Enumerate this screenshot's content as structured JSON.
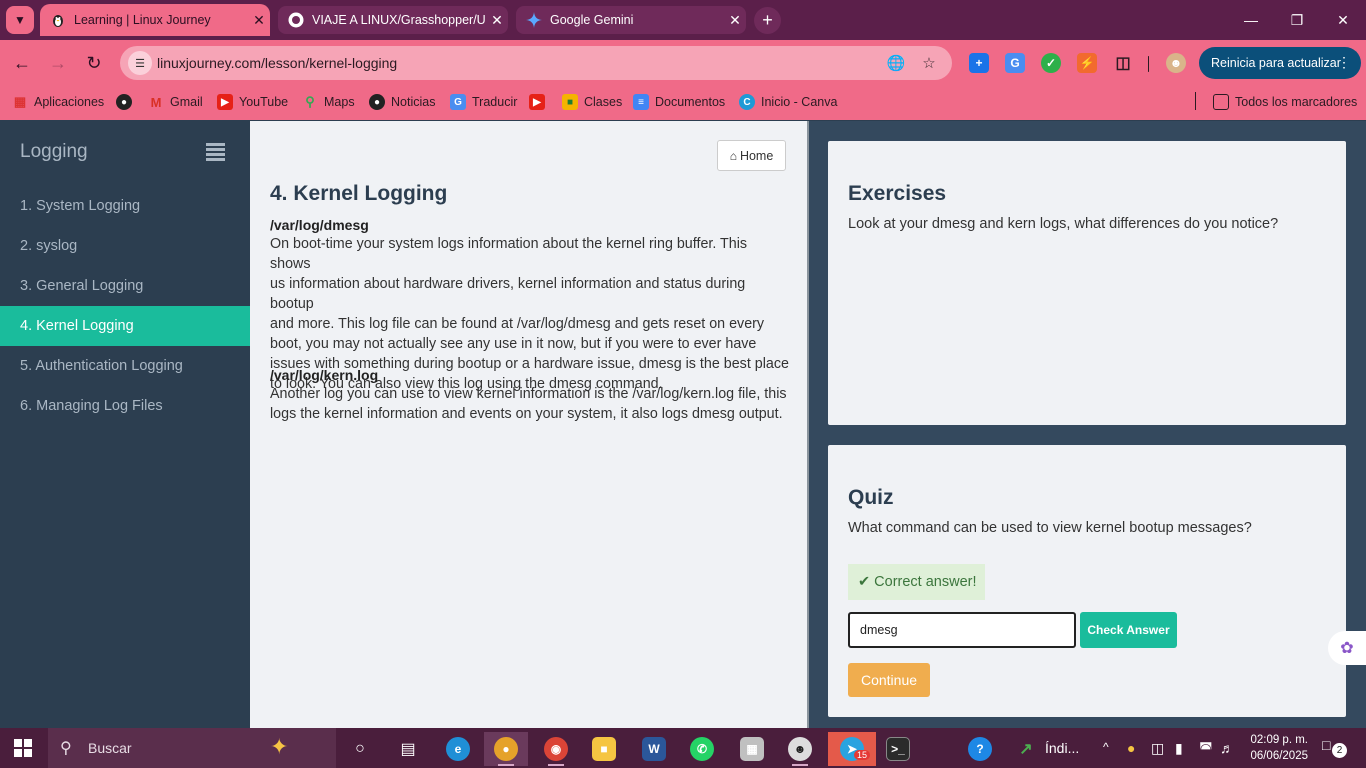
{
  "browser": {
    "tabs": [
      {
        "title": "Learning | Linux Journey",
        "icon": "linux-penguin-icon"
      },
      {
        "title": "VIAJE A LINUX/Grasshopper/Us",
        "icon": "github-icon"
      },
      {
        "title": "Google Gemini",
        "icon": "gemini-icon"
      }
    ],
    "url": "linuxjourney.com/lesson/kernel-logging",
    "update_button": "Reinicia para actualizar",
    "bookmarks": [
      {
        "label": "Aplicaciones",
        "icon": "apps-grid-icon"
      },
      {
        "label": "",
        "icon": "globe-icon"
      },
      {
        "label": "Gmail",
        "icon": "gmail-icon"
      },
      {
        "label": "YouTube",
        "icon": "youtube-icon"
      },
      {
        "label": "Maps",
        "icon": "maps-icon"
      },
      {
        "label": "Noticias",
        "icon": "globe-icon"
      },
      {
        "label": "Traducir",
        "icon": "translate-icon"
      },
      {
        "label": "",
        "icon": "youtube-icon"
      },
      {
        "label": "Clases",
        "icon": "classroom-icon"
      },
      {
        "label": "Documentos",
        "icon": "docs-icon"
      },
      {
        "label": "Inicio - Canva",
        "icon": "canva-icon"
      }
    ],
    "all_bookmarks": "Todos los marcadores"
  },
  "sidebar": {
    "title": "Logging",
    "items": [
      {
        "label": "1. System Logging",
        "active": false
      },
      {
        "label": "2. syslog",
        "active": false
      },
      {
        "label": "3. General Logging",
        "active": false
      },
      {
        "label": "4. Kernel Logging",
        "active": true
      },
      {
        "label": "5. Authentication Logging",
        "active": false
      },
      {
        "label": "6. Managing Log Files",
        "active": false
      }
    ]
  },
  "lesson": {
    "home_button": "Home",
    "title": "4. Kernel Logging",
    "sections": [
      {
        "heading": "/var/log/dmesg",
        "lines": [
          "On boot-time your system logs information about the kernel ring buffer. This shows",
          "us information about hardware drivers, kernel information and status during bootup",
          "and more. This log file can be found at /var/log/dmesg and gets reset on every",
          "boot, you may not actually see any use in it now, but if you were to ever have",
          "issues with something during bootup or a hardware issue, dmesg is the best place",
          "to look. You can also view this log using the dmesg command."
        ]
      },
      {
        "heading": "/var/log/kern.log",
        "lines": [
          "Another log you can use to view kernel information is the /var/log/kern.log file, this",
          "logs the kernel information and events on your system, it also logs dmesg output."
        ]
      }
    ]
  },
  "exercises": {
    "title": "Exercises",
    "text": "Look at your dmesg and kern logs, what differences do you notice?"
  },
  "quiz": {
    "title": "Quiz",
    "question": "What command can be used to view kernel bootup messages?",
    "feedback": "Correct answer!",
    "answer_value": "dmesg",
    "check_button": "Check Answer",
    "continue_button": "Continue"
  },
  "taskbar": {
    "search_label": "Buscar",
    "stock_label": "Índi...",
    "telegram_badge": "15",
    "time": "02:09 p. m.",
    "date": "06/06/2025",
    "notifications": "2"
  },
  "colors": {
    "accent": "#1abc9c",
    "sidebar_bg": "#2c3e50",
    "browser_frame": "#f06a88",
    "continue": "#f0ad4e",
    "success_bg": "#dff0d8"
  }
}
